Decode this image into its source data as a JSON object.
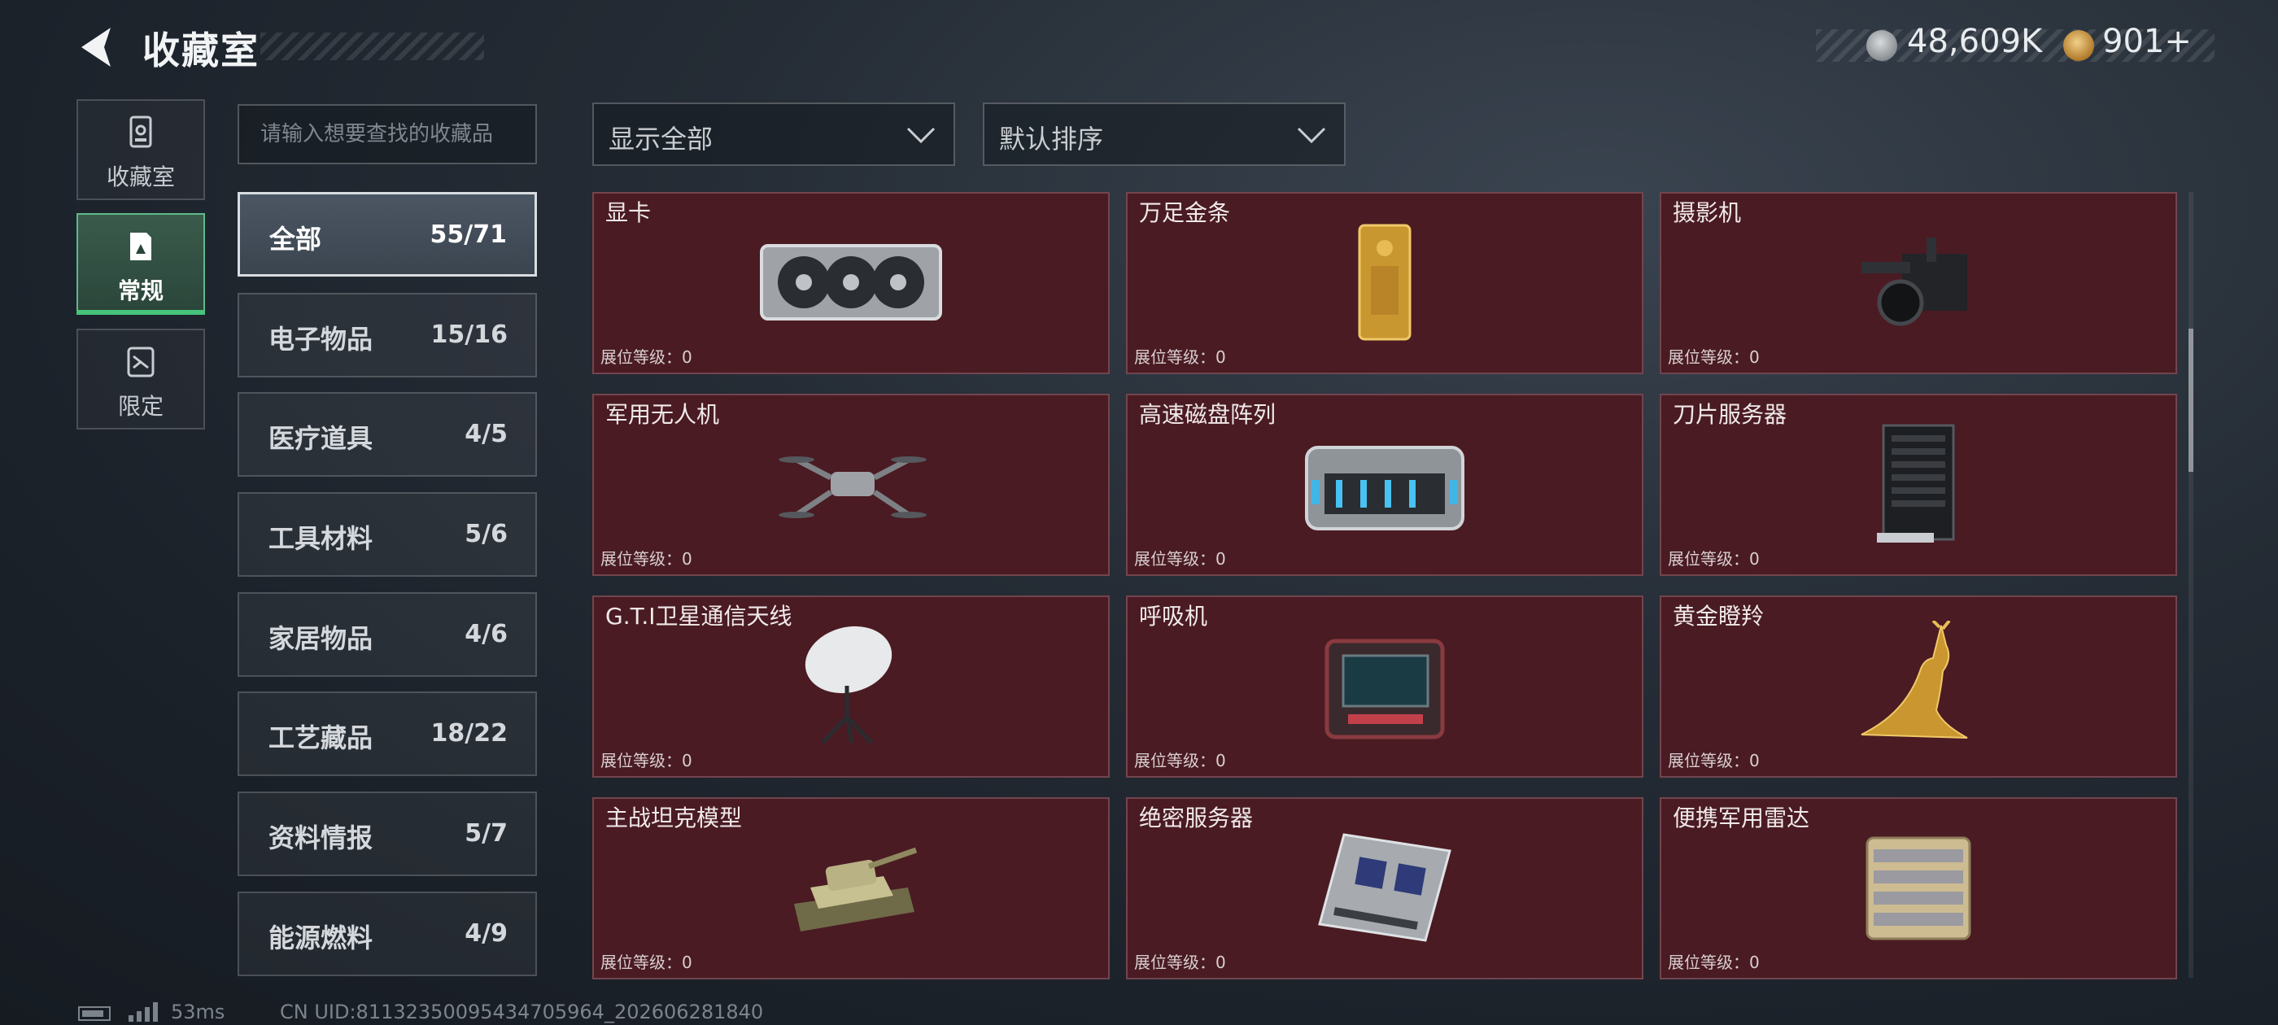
{
  "header": {
    "title": "收藏室",
    "currencies": [
      {
        "icon": "silver-coin-icon",
        "value": "48,609K"
      },
      {
        "icon": "gold-coin-icon",
        "value": "901+"
      }
    ]
  },
  "side_tabs": [
    {
      "label": "收藏室",
      "icon": "collection-room-icon"
    },
    {
      "label": "常规",
      "icon": "regular-icon",
      "active": true
    },
    {
      "label": "限定",
      "icon": "limited-icon"
    }
  ],
  "search": {
    "placeholder": "请输入想要查找的收藏品",
    "value": ""
  },
  "filter": {
    "selected": "显示全部"
  },
  "sort": {
    "selected": "默认排序"
  },
  "categories": [
    {
      "name": "全部",
      "count": "55/71",
      "active": true
    },
    {
      "name": "电子物品",
      "count": "15/16"
    },
    {
      "name": "医疗道具",
      "count": "4/5"
    },
    {
      "name": "工具材料",
      "count": "5/6"
    },
    {
      "name": "家居物品",
      "count": "4/6"
    },
    {
      "name": "工艺藏品",
      "count": "18/22"
    },
    {
      "name": "资料情报",
      "count": "5/7"
    },
    {
      "name": "能源燃料",
      "count": "4/9"
    }
  ],
  "items": [
    {
      "name": "显卡",
      "level": "展位等级：0",
      "icon": "graphics-card-icon"
    },
    {
      "name": "万足金条",
      "level": "展位等级：0",
      "icon": "gold-bar-icon"
    },
    {
      "name": "摄影机",
      "level": "展位等级：0",
      "icon": "video-camera-icon"
    },
    {
      "name": "军用无人机",
      "level": "展位等级：0",
      "icon": "drone-icon"
    },
    {
      "name": "高速磁盘阵列",
      "level": "展位等级：0",
      "icon": "disk-array-icon"
    },
    {
      "name": "刀片服务器",
      "level": "展位等级：0",
      "icon": "blade-server-icon"
    },
    {
      "name": "G.T.I卫星通信天线",
      "level": "展位等级：0",
      "icon": "satellite-dish-icon"
    },
    {
      "name": "呼吸机",
      "level": "展位等级：0",
      "icon": "ventilator-icon"
    },
    {
      "name": "黄金瞪羚",
      "level": "展位等级：0",
      "icon": "gold-gazelle-icon"
    },
    {
      "name": "主战坦克模型",
      "level": "展位等级：0",
      "icon": "tank-model-icon"
    },
    {
      "name": "绝密服务器",
      "level": "展位等级：0",
      "icon": "secret-server-icon"
    },
    {
      "name": "便携军用雷达",
      "level": "展位等级：0",
      "icon": "portable-radar-icon"
    }
  ],
  "footer": {
    "ping": "53ms",
    "uid": "CN UID:81132350095434705964_202606281840"
  },
  "colors": {
    "card_bg": "#4a1b22",
    "active_tab": "#45c47a"
  }
}
